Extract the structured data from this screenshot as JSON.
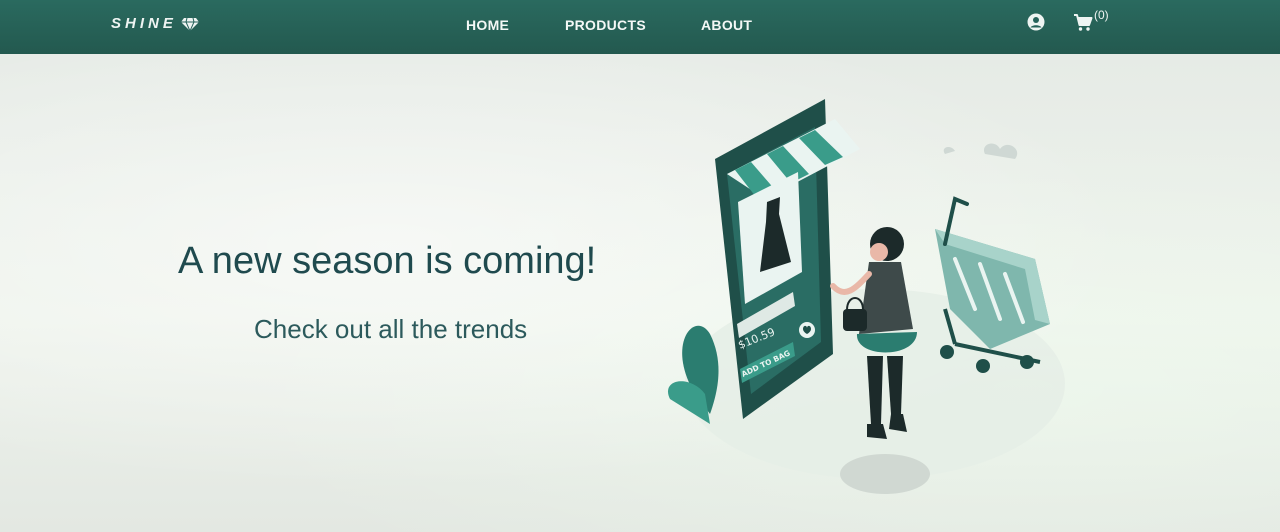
{
  "brand": {
    "name": "SHINE",
    "icon": "diamond-icon"
  },
  "nav": {
    "links": [
      {
        "label": "HOME"
      },
      {
        "label": "PRODUCTS"
      },
      {
        "label": "ABOUT"
      }
    ],
    "user_icon": "user-circle-icon",
    "cart_icon": "shopping-cart-icon",
    "cart_count": "(0)"
  },
  "hero": {
    "headline": "A new season is coming!",
    "subline": "Check out all the trends",
    "illustration": {
      "price": "$10.59",
      "button_label": "ADD TO BAG"
    }
  },
  "colors": {
    "nav_bg": "#26625a",
    "accent": "#3a9c8a",
    "text_dark": "#1f4a4e"
  }
}
